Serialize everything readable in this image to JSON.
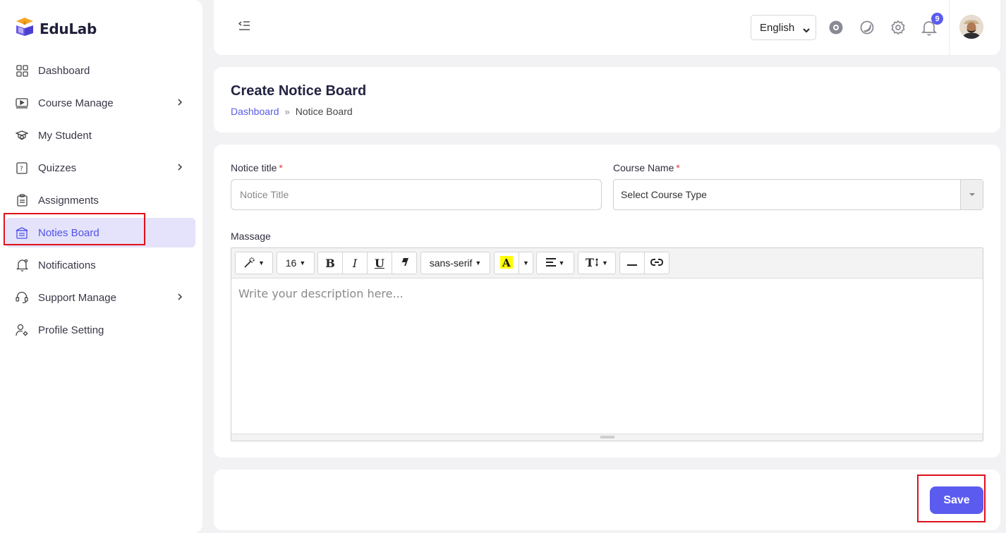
{
  "brand": {
    "name": "EduLab"
  },
  "sidebar": {
    "items": [
      {
        "label": "Dashboard",
        "icon": "grid-icon",
        "has_children": false,
        "active": false
      },
      {
        "label": "Course Manage",
        "icon": "video-icon",
        "has_children": true,
        "active": false
      },
      {
        "label": "My Student",
        "icon": "graduation-cap-icon",
        "has_children": false,
        "active": false
      },
      {
        "label": "Quizzes",
        "icon": "quiz-icon",
        "has_children": true,
        "active": false
      },
      {
        "label": "Assignments",
        "icon": "clipboard-icon",
        "has_children": false,
        "active": false
      },
      {
        "label": "Noties Board",
        "icon": "notice-board-icon",
        "has_children": false,
        "active": true
      },
      {
        "label": "Notifications",
        "icon": "bell-icon",
        "has_children": false,
        "active": false
      },
      {
        "label": "Support Manage",
        "icon": "headset-icon",
        "has_children": true,
        "active": false
      },
      {
        "label": "Profile Setting",
        "icon": "user-gear-icon",
        "has_children": false,
        "active": false
      }
    ]
  },
  "topbar": {
    "language": "English",
    "notification_count": "9"
  },
  "header": {
    "title": "Create Notice Board",
    "breadcrumb": {
      "home": "Dashboard",
      "separator": "»",
      "current": "Notice Board"
    }
  },
  "form": {
    "notice_title": {
      "label": "Notice title",
      "required": "*",
      "placeholder": "Notice Title"
    },
    "course_name": {
      "label": "Course Name",
      "required": "*",
      "selected": "Select Course Type"
    },
    "message": {
      "label": "Massage",
      "placeholder": "Write your description here...",
      "toolbar": {
        "font_size": "16",
        "font_family": "sans-serif"
      }
    }
  },
  "actions": {
    "save_label": "Save"
  },
  "colors": {
    "accent": "#5b5bf0",
    "active_bg": "#e4e3fb",
    "highlight": "#e0101a"
  }
}
